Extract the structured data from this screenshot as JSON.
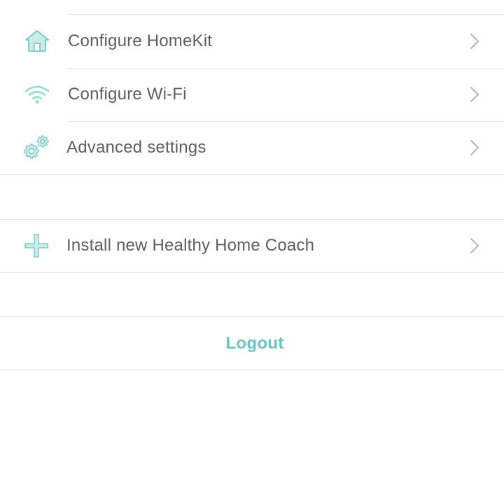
{
  "menu": {
    "items": [
      {
        "label": "Configure HomeKit",
        "icon": "home-icon"
      },
      {
        "label": "Configure Wi-Fi",
        "icon": "wifi-icon"
      },
      {
        "label": "Advanced settings",
        "icon": "gears-icon"
      }
    ]
  },
  "install": {
    "label": "Install new Healthy Home Coach",
    "icon": "plus-icon"
  },
  "logout": {
    "label": "Logout"
  },
  "colors": {
    "accent": "#6cc3bd",
    "icon_fill": "#c9ecea",
    "text": "#5e5e5e",
    "divider": "#e3e3e3",
    "chevron": "#b8b8b8"
  }
}
